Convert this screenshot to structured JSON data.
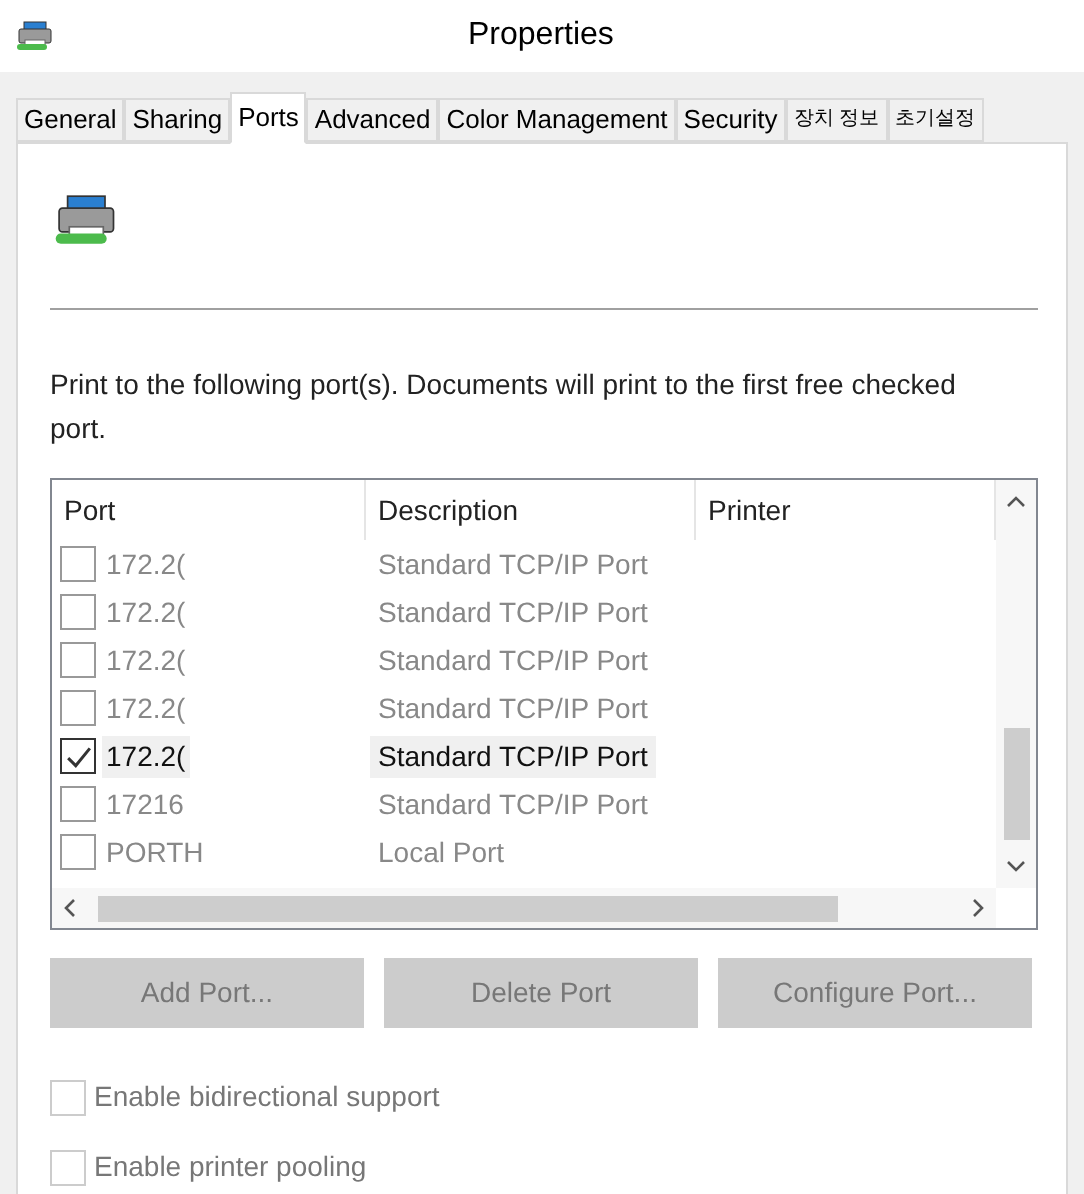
{
  "window": {
    "title": "Properties"
  },
  "tabs": [
    {
      "label": "General",
      "selected": false
    },
    {
      "label": "Sharing",
      "selected": false
    },
    {
      "label": "Ports",
      "selected": true
    },
    {
      "label": "Advanced",
      "selected": false
    },
    {
      "label": "Color Management",
      "selected": false
    },
    {
      "label": "Security",
      "selected": false
    },
    {
      "label": "장치 정보",
      "selected": false
    },
    {
      "label": "초기설정",
      "selected": false
    }
  ],
  "instructions": "Print to the following port(s). Documents will print to the first free checked port.",
  "port_list": {
    "columns": [
      "Port",
      "Description",
      "Printer"
    ],
    "rows": [
      {
        "port": "172.2(",
        "description": "Standard TCP/IP Port",
        "checked": false,
        "selected": false
      },
      {
        "port": "172.2(",
        "description": "Standard TCP/IP Port",
        "checked": false,
        "selected": false
      },
      {
        "port": "172.2(",
        "description": "Standard TCP/IP Port",
        "checked": false,
        "selected": false
      },
      {
        "port": "172.2(",
        "description": "Standard TCP/IP Port",
        "checked": false,
        "selected": false
      },
      {
        "port": "172.2(",
        "description": "Standard TCP/IP Port",
        "checked": true,
        "selected": true
      },
      {
        "port": "17216",
        "description": "Standard TCP/IP Port",
        "checked": false,
        "selected": false
      },
      {
        "port": "PORTH",
        "description": "Local Port",
        "checked": false,
        "selected": false
      }
    ]
  },
  "buttons": [
    {
      "label": "Add Port...",
      "disabled": true
    },
    {
      "label": "Delete Port",
      "disabled": true
    },
    {
      "label": "Configure Port...",
      "disabled": true
    }
  ],
  "options": [
    {
      "label": "Enable bidirectional support",
      "checked": false,
      "disabled": true
    },
    {
      "label": "Enable printer pooling",
      "checked": false,
      "disabled": true
    }
  ]
}
